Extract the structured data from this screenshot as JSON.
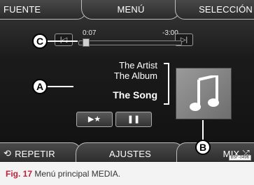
{
  "tabs": {
    "fuente": "FUENTE",
    "menu": "MENÚ",
    "seleccion": "SELECCIÓN",
    "repetir": "REPETIR",
    "ajustes": "AJUSTES",
    "mix": "MIX"
  },
  "player": {
    "elapsed": "0:07",
    "remaining": "-3:00",
    "progress_fraction": 0.04,
    "artist": "The Artist",
    "album": "The Album",
    "song": "The Song"
  },
  "callouts": {
    "a": "A",
    "b": "B",
    "c": "C"
  },
  "ref_code": "B5F-0496",
  "caption": {
    "label": "Fig. 17",
    "text": "Menú principal MEDIA."
  },
  "colors": {
    "caption_label": "#c0213a",
    "screen_bg": "#1b1b1b",
    "cover_bg": "#8a8a8a"
  },
  "icons": [
    "skip-prev-icon",
    "skip-next-icon",
    "repeat-icon",
    "shuffle-icon",
    "play-favorite-icon",
    "pause-icon",
    "music-note-icon"
  ]
}
